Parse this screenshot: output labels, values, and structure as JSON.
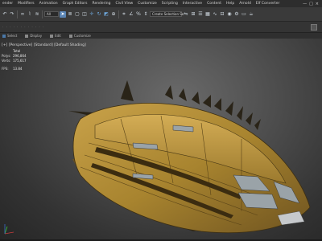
{
  "menubar": {
    "items": [
      "ender",
      "Modifiers",
      "Animation",
      "Graph Editors",
      "Rendering",
      "Civil View",
      "Customize",
      "Scripting",
      "Interactive",
      "Content",
      "Help",
      "Arnold",
      "Elf Converter"
    ],
    "window_controls": [
      "—",
      "□",
      "×"
    ]
  },
  "toolbar": {
    "selection_filter": "All",
    "named_selection": "Create Selection Se",
    "icons": [
      "undo-icon",
      "redo-icon",
      "link-icon",
      "unlink-icon",
      "bind-icon",
      "select-icon",
      "select-by-name-icon",
      "rect-select-icon",
      "window-crossing-icon",
      "move-icon",
      "rotate-icon",
      "scale-icon",
      "pivot-icon",
      "snap-icon",
      "angle-snap-icon",
      "percent-snap-icon",
      "spinner-snap-icon",
      "mirror-icon",
      "align-icon",
      "layers-icon",
      "graphite-icon",
      "curve-editor-icon",
      "schematic-icon",
      "material-editor-icon",
      "render-setup-icon",
      "render-frame-icon",
      "render-icon"
    ]
  },
  "tabs": [
    "Select",
    "Display",
    "Edit",
    "Customize"
  ],
  "viewport": {
    "label": "[+] [Perspective] [Standard] [Default Shading]",
    "stats": {
      "header": "Total",
      "rows": [
        {
          "k": "Polys:",
          "v": "296,864"
        },
        {
          "k": "Verts:",
          "v": "175,617"
        }
      ],
      "fps_label": "FPS:",
      "fps_value": "13.84"
    }
  },
  "colors": {
    "active_tool": "#5b85b5",
    "hull_base": "#b08a3a",
    "hull_dark": "#6f5420",
    "window_grey": "#9aa3a8"
  }
}
